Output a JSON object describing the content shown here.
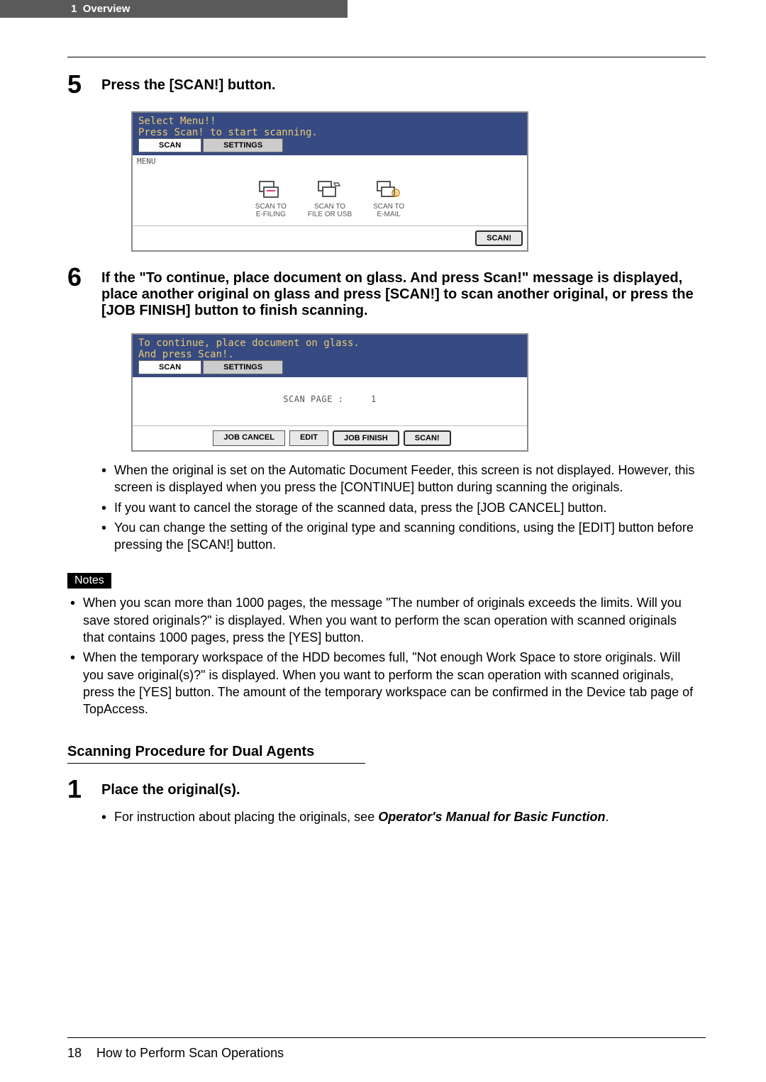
{
  "header": {
    "chapter_num": "1",
    "chapter_title": "Overview"
  },
  "step5": {
    "num": "5",
    "title": "Press the [SCAN!] button.",
    "panel": {
      "top_line1": "Select Menu!!",
      "top_line2": "Press Scan! to start scanning.",
      "tab_scan": "SCAN",
      "tab_settings": "SETTINGS",
      "menu_label": "MENU",
      "icons": {
        "efiling": "SCAN TO\nE-FILING",
        "fileusb": "SCAN TO\nFILE OR USB",
        "email": "SCAN TO\nE-MAIL"
      },
      "btn_scan": "SCAN!"
    }
  },
  "step6": {
    "num": "6",
    "title": "If the \"To continue, place document on glass. And press Scan!\" message is displayed, place another original on glass and press [SCAN!] to scan another original, or press the [JOB FINISH] button to finish scanning.",
    "panel": {
      "top_line1": "To continue, place document on glass.",
      "top_line2": "And press Scan!.",
      "tab_scan": "SCAN",
      "tab_settings": "SETTINGS",
      "center_label": "SCAN PAGE :",
      "center_value": "1",
      "btn_jobcancel": "JOB CANCEL",
      "btn_edit": "EDIT",
      "btn_jobfinish": "JOB FINISH",
      "btn_scan": "SCAN!"
    },
    "bullets": {
      "b1": "When the original is set on the Automatic Document Feeder, this screen is not displayed. However, this screen is displayed when you press the [CONTINUE] button during scanning the originals.",
      "b2": "If you want to cancel the storage of the scanned data, press the [JOB CANCEL] button.",
      "b3": "You can change the setting of the original type and scanning conditions, using the [EDIT] button before pressing the [SCAN!] button."
    }
  },
  "notes": {
    "label": "Notes",
    "n1": "When you scan more than 1000 pages, the message \"The number of originals exceeds the limits. Will you save stored originals?\" is displayed. When you want to perform the scan operation with scanned originals that contains 1000 pages, press the [YES] button.",
    "n2": "When the temporary workspace of the HDD becomes full, \"Not enough Work Space to store originals. Will you save original(s)?\" is displayed. When you want to perform the scan operation with scanned originals, press the [YES] button. The amount of the temporary workspace can be confirmed in the Device tab page of TopAccess."
  },
  "sub": {
    "heading": "Scanning Procedure for Dual Agents",
    "step1_num": "1",
    "step1_title": "Place the original(s).",
    "step1_bullet_prefix": "For instruction about placing the originals, see ",
    "step1_bullet_em": "Operator's Manual for Basic Function",
    "step1_bullet_suffix": "."
  },
  "footer": {
    "page_num": "18",
    "page_title": "How to Perform Scan Operations"
  }
}
